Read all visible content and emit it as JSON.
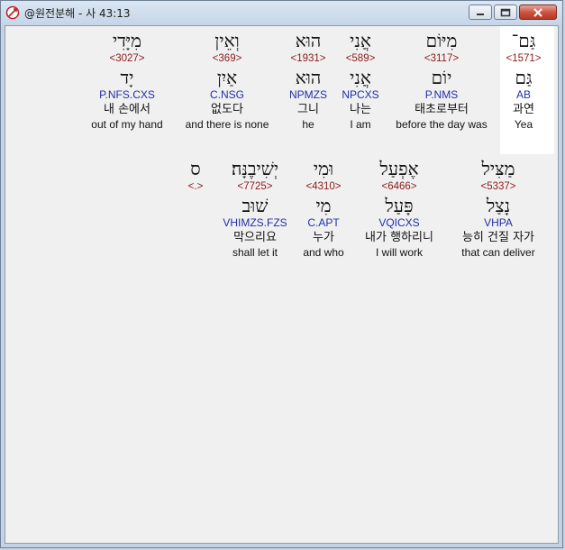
{
  "window": {
    "title": "@원전분해 - 사 43:13"
  },
  "row1": [
    {
      "heb": "גַּם־",
      "strong": "<1571>",
      "lemma": "גַּם",
      "morph": "AB",
      "ko": "과연",
      "en": "Yea"
    },
    {
      "heb": "מִיּוֹם",
      "strong": "<3117>",
      "lemma": "יוֹם",
      "morph": "P.NMS",
      "ko": "태초로부터",
      "en": "before the day was"
    },
    {
      "heb": "אֲנִי",
      "strong": "<589>",
      "lemma": "אֲנִי",
      "morph": "NPCXS",
      "ko": "나는",
      "en": "I am"
    },
    {
      "heb": "הוּא",
      "strong": "<1931>",
      "lemma": "הוּא",
      "morph": "NPMZS",
      "ko": "그니",
      "en": "he"
    },
    {
      "heb": "וְאֵין",
      "strong": "<369>",
      "lemma": "אַיִן",
      "morph": "C.NSG",
      "ko": "없도다",
      "en": "and there is none"
    },
    {
      "heb": "מִיָּדִי",
      "strong": "<3027>",
      "lemma": "יָד",
      "morph": "P.NFS.CXS",
      "ko": "내 손에서",
      "en": "out of my hand"
    }
  ],
  "row2": [
    {
      "heb": "מַצִּיל",
      "strong": "<5337>",
      "lemma": "נָצַל",
      "morph": "VHPA",
      "ko": "능히 건질 자가",
      "en": "that can deliver"
    },
    {
      "heb": "אֶפְעַל",
      "strong": "<6466>",
      "lemma": "פָּעַל",
      "morph": "VQICXS",
      "ko": "내가 행하리니",
      "en": "I will work"
    },
    {
      "heb": "וּמִי",
      "strong": "<4310>",
      "lemma": "מִי",
      "morph": "C.APT",
      "ko": "누가",
      "en": "and who"
    },
    {
      "heb": "יְשִׁיבֶנָּה׃",
      "strong": "<7725>",
      "lemma": "שׁוּב",
      "morph": "VHIMZS.FZS",
      "ko": "막으리요",
      "en": "shall let it"
    },
    {
      "heb": "ס",
      "strong": "<.>",
      "lemma": "",
      "morph": "",
      "ko": "",
      "en": ""
    }
  ]
}
